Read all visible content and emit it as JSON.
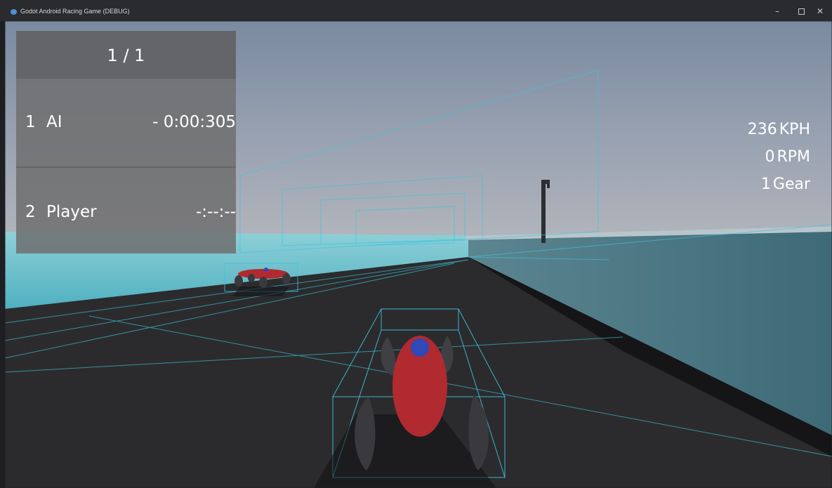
{
  "window": {
    "title": "Godot Android Racing Game (DEBUG)",
    "minimize_icon": "–",
    "close_icon": "✕"
  },
  "race": {
    "lap": "1 / 1",
    "standings": [
      {
        "position": "1",
        "name": "AI",
        "time": "- 0:00:305"
      },
      {
        "position": "2",
        "name": "Player",
        "time": "-:--:--"
      }
    ]
  },
  "telemetry": {
    "speed_value": "236",
    "speed_unit": "KPH",
    "rpm_value": "0",
    "rpm_unit": "RPM",
    "gear_value": "1",
    "gear_unit": "Gear"
  },
  "colors": {
    "car_body": "#b02a30",
    "driver_head": "#3048b8",
    "debug_wireframe": "#3fc3dd",
    "track": "#2b2b2d",
    "water": "#6fbcc8"
  }
}
